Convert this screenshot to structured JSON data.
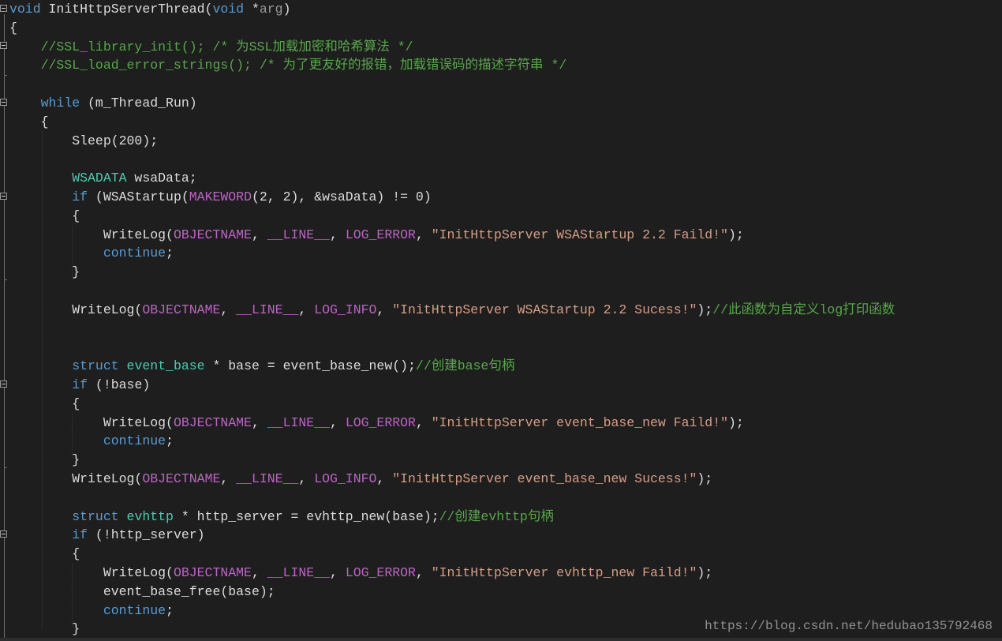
{
  "watermark": "https://blog.csdn.net/hedubao135792468",
  "code_lines": [
    [
      {
        "t": "void",
        "k": "kw"
      },
      {
        "t": " InitHttpServerThread(",
        "k": "plain"
      },
      {
        "t": "void",
        "k": "kw"
      },
      {
        "t": " *",
        "k": "plain"
      },
      {
        "t": "arg",
        "k": "param"
      },
      {
        "t": ")",
        "k": "plain"
      }
    ],
    [
      {
        "t": "{",
        "k": "plain"
      }
    ],
    [
      {
        "t": "    //SSL_library_init(); /* 为SSL加载加密和哈希算法 */",
        "k": "comment"
      }
    ],
    [
      {
        "t": "    //SSL_load_error_strings(); /* 为了更友好的报错，加载错误码的描述字符串 */",
        "k": "comment"
      }
    ],
    [],
    [
      {
        "t": "    ",
        "k": "plain"
      },
      {
        "t": "while",
        "k": "kw"
      },
      {
        "t": " (m_Thread_Run)",
        "k": "plain"
      }
    ],
    [
      {
        "t": "    {",
        "k": "plain"
      }
    ],
    [
      {
        "t": "        Sleep(200);",
        "k": "plain"
      }
    ],
    [],
    [
      {
        "t": "        ",
        "k": "plain"
      },
      {
        "t": "WSADATA",
        "k": "type"
      },
      {
        "t": " wsaData;",
        "k": "plain"
      }
    ],
    [
      {
        "t": "        ",
        "k": "plain"
      },
      {
        "t": "if",
        "k": "kw"
      },
      {
        "t": " (WSAStartup(",
        "k": "plain"
      },
      {
        "t": "MAKEWORD",
        "k": "macro"
      },
      {
        "t": "(2, 2), &wsaData) != 0)",
        "k": "plain"
      }
    ],
    [
      {
        "t": "        {",
        "k": "plain"
      }
    ],
    [
      {
        "t": "            WriteLog(",
        "k": "plain"
      },
      {
        "t": "OBJECTNAME",
        "k": "macro"
      },
      {
        "t": ", ",
        "k": "plain"
      },
      {
        "t": "__LINE__",
        "k": "macro"
      },
      {
        "t": ", ",
        "k": "plain"
      },
      {
        "t": "LOG_ERROR",
        "k": "macro"
      },
      {
        "t": ", ",
        "k": "plain"
      },
      {
        "t": "\"InitHttpServer WSAStartup 2.2 Faild!\"",
        "k": "string"
      },
      {
        "t": ");",
        "k": "plain"
      }
    ],
    [
      {
        "t": "            ",
        "k": "plain"
      },
      {
        "t": "continue",
        "k": "kw"
      },
      {
        "t": ";",
        "k": "plain"
      }
    ],
    [
      {
        "t": "        }",
        "k": "plain"
      }
    ],
    [],
    [
      {
        "t": "        WriteLog(",
        "k": "plain"
      },
      {
        "t": "OBJECTNAME",
        "k": "macro"
      },
      {
        "t": ", ",
        "k": "plain"
      },
      {
        "t": "__LINE__",
        "k": "macro"
      },
      {
        "t": ", ",
        "k": "plain"
      },
      {
        "t": "LOG_INFO",
        "k": "macro"
      },
      {
        "t": ", ",
        "k": "plain"
      },
      {
        "t": "\"InitHttpServer WSAStartup 2.2 Sucess!\"",
        "k": "string"
      },
      {
        "t": ");",
        "k": "plain"
      },
      {
        "t": "//此函数为自定义log打印函数",
        "k": "comment"
      }
    ],
    [],
    [],
    [
      {
        "t": "        ",
        "k": "plain"
      },
      {
        "t": "struct",
        "k": "kw"
      },
      {
        "t": " ",
        "k": "plain"
      },
      {
        "t": "event_base",
        "k": "type"
      },
      {
        "t": " * base = event_base_new();",
        "k": "plain"
      },
      {
        "t": "//创建base句柄",
        "k": "comment"
      }
    ],
    [
      {
        "t": "        ",
        "k": "plain"
      },
      {
        "t": "if",
        "k": "kw"
      },
      {
        "t": " (!base)",
        "k": "plain"
      }
    ],
    [
      {
        "t": "        {",
        "k": "plain"
      }
    ],
    [
      {
        "t": "            WriteLog(",
        "k": "plain"
      },
      {
        "t": "OBJECTNAME",
        "k": "macro"
      },
      {
        "t": ", ",
        "k": "plain"
      },
      {
        "t": "__LINE__",
        "k": "macro"
      },
      {
        "t": ", ",
        "k": "plain"
      },
      {
        "t": "LOG_ERROR",
        "k": "macro"
      },
      {
        "t": ", ",
        "k": "plain"
      },
      {
        "t": "\"InitHttpServer event_base_new Faild!\"",
        "k": "string"
      },
      {
        "t": ");",
        "k": "plain"
      }
    ],
    [
      {
        "t": "            ",
        "k": "plain"
      },
      {
        "t": "continue",
        "k": "kw"
      },
      {
        "t": ";",
        "k": "plain"
      }
    ],
    [
      {
        "t": "        }",
        "k": "plain"
      }
    ],
    [
      {
        "t": "        WriteLog(",
        "k": "plain"
      },
      {
        "t": "OBJECTNAME",
        "k": "macro"
      },
      {
        "t": ", ",
        "k": "plain"
      },
      {
        "t": "__LINE__",
        "k": "macro"
      },
      {
        "t": ", ",
        "k": "plain"
      },
      {
        "t": "LOG_INFO",
        "k": "macro"
      },
      {
        "t": ", ",
        "k": "plain"
      },
      {
        "t": "\"InitHttpServer event_base_new Sucess!\"",
        "k": "string"
      },
      {
        "t": ");",
        "k": "plain"
      }
    ],
    [],
    [
      {
        "t": "        ",
        "k": "plain"
      },
      {
        "t": "struct",
        "k": "kw"
      },
      {
        "t": " ",
        "k": "plain"
      },
      {
        "t": "evhttp",
        "k": "type"
      },
      {
        "t": " * http_server = evhttp_new(base);",
        "k": "plain"
      },
      {
        "t": "//创建evhttp句柄",
        "k": "comment"
      }
    ],
    [
      {
        "t": "        ",
        "k": "plain"
      },
      {
        "t": "if",
        "k": "kw"
      },
      {
        "t": " (!http_server)",
        "k": "plain"
      }
    ],
    [
      {
        "t": "        {",
        "k": "plain"
      }
    ],
    [
      {
        "t": "            WriteLog(",
        "k": "plain"
      },
      {
        "t": "OBJECTNAME",
        "k": "macro"
      },
      {
        "t": ", ",
        "k": "plain"
      },
      {
        "t": "__LINE__",
        "k": "macro"
      },
      {
        "t": ", ",
        "k": "plain"
      },
      {
        "t": "LOG_ERROR",
        "k": "macro"
      },
      {
        "t": ", ",
        "k": "plain"
      },
      {
        "t": "\"InitHttpServer evhttp_new Faild!\"",
        "k": "string"
      },
      {
        "t": ");",
        "k": "plain"
      }
    ],
    [
      {
        "t": "            event_base_free(base);",
        "k": "plain"
      }
    ],
    [
      {
        "t": "            ",
        "k": "plain"
      },
      {
        "t": "continue",
        "k": "kw"
      },
      {
        "t": ";",
        "k": "plain"
      }
    ],
    [
      {
        "t": "        }",
        "k": "plain"
      }
    ]
  ],
  "colors": {
    "background": "#1e1e1e",
    "keyword": "#569cd6",
    "plain": "#dcdcdc",
    "comment": "#57a64a",
    "macro": "#bd63c5",
    "string": "#d69d85",
    "type": "#4ec9b0",
    "param": "#9a9a9a"
  },
  "fold_markers": [
    "collapse-icon",
    "collapse-icon",
    "collapse-icon",
    "collapse-icon",
    "collapse-icon",
    "collapse-icon"
  ]
}
